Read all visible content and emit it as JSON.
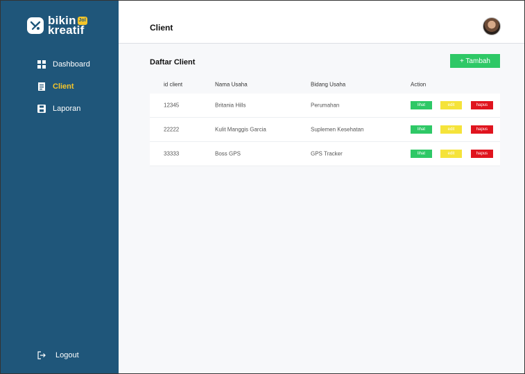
{
  "brand": {
    "line1": "bikin",
    "badge": "Jol",
    "line2": "kreatif"
  },
  "sidebar": {
    "items": [
      {
        "label": "Dashboard",
        "icon": "dashboard-icon",
        "active": false
      },
      {
        "label": "Client",
        "icon": "client-icon",
        "active": true
      },
      {
        "label": "Laporan",
        "icon": "report-icon",
        "active": false
      }
    ],
    "logout": "Logout"
  },
  "header": {
    "title": "Client"
  },
  "main": {
    "section_title": "Daftar Client",
    "add_button": "+ Tambah",
    "columns": [
      "id client",
      "Nama Usaha",
      "Bidang Usaha",
      "Action"
    ],
    "rows": [
      {
        "id": "12345",
        "nama": "Britania Hills",
        "bidang": "Perumahan"
      },
      {
        "id": "22222",
        "nama": "Kulit Manggis Garcia",
        "bidang": "Suplemen Kesehatan"
      },
      {
        "id": "33333",
        "nama": "Boss GPS",
        "bidang": "GPS Tracker"
      }
    ],
    "actions": {
      "view": "lihat",
      "edit": "edit",
      "delete": "hapus"
    }
  },
  "colors": {
    "sidebar": "#1f567a",
    "accent": "#f5c52a",
    "green": "#2ec866",
    "yellow": "#f5e33a",
    "red": "#e0141e"
  }
}
